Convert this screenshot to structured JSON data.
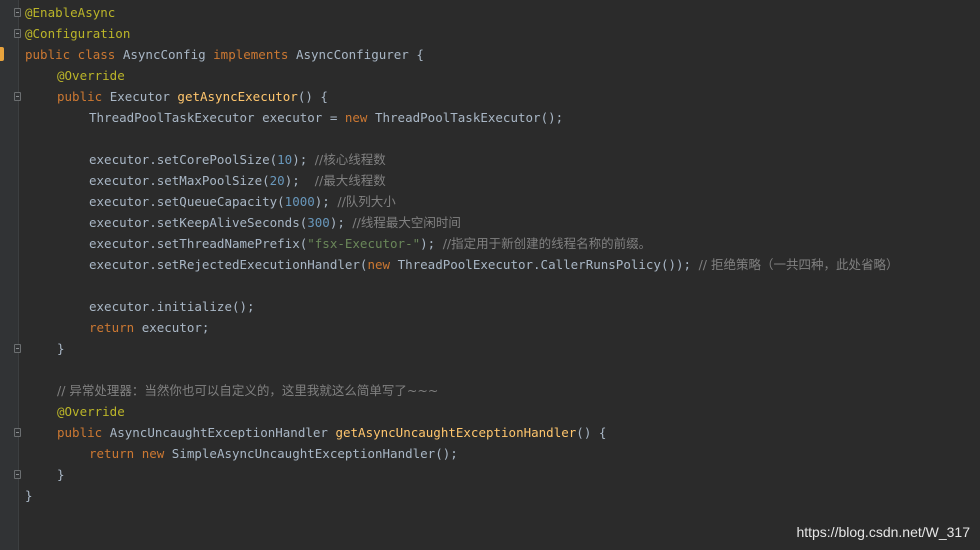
{
  "code": {
    "l1": "@EnableAsync",
    "l2": "@Configuration",
    "l3": {
      "a": "public class ",
      "b": "AsyncConfig ",
      "c": "implements ",
      "d": "AsyncConfigurer {"
    },
    "l4": "@Override",
    "l5": {
      "a": "public ",
      "b": "Executor ",
      "c": "getAsyncExecutor",
      "d": "() {"
    },
    "l6": {
      "a": "ThreadPoolTaskExecutor executor = ",
      "b": "new ",
      "c": "ThreadPoolTaskExecutor",
      "d": "();"
    },
    "l8": {
      "a": "executor.setCorePoolSize(",
      "b": "10",
      "c": "); ",
      "d": "//核心线程数"
    },
    "l9": {
      "a": "executor.setMaxPoolSize(",
      "b": "20",
      "c": ");  ",
      "d": "//最大线程数"
    },
    "l10": {
      "a": "executor.setQueueCapacity(",
      "b": "1000",
      "c": "); ",
      "d": "//队列大小"
    },
    "l11": {
      "a": "executor.setKeepAliveSeconds(",
      "b": "300",
      "c": "); ",
      "d": "//线程最大空闲时间"
    },
    "l12": {
      "a": "executor.setThreadNamePrefix(",
      "b": "\"fsx-Executor-\"",
      "c": "); ",
      "d": "//指定用于新创建的线程名称的前缀。"
    },
    "l13": {
      "a": "executor.setRejectedExecutionHandler(",
      "b": "new ",
      "c": "ThreadPoolExecutor.CallerRunsPolicy()); ",
      "d": "// 拒绝策略（一共四种，此处省略）"
    },
    "l15": "executor.initialize();",
    "l16": {
      "a": "return ",
      "b": "executor;"
    },
    "l17": "}",
    "l19": "// 异常处理器：当然你也可以自定义的，这里我就这么简单写了~~~",
    "l20": "@Override",
    "l21": {
      "a": "public ",
      "b": "AsyncUncaughtExceptionHandler ",
      "c": "getAsyncUncaughtExceptionHandler",
      "d": "() {"
    },
    "l22": {
      "a": "return ",
      "b": "new ",
      "c": "SimpleAsyncUncaughtExceptionHandler();"
    },
    "l23": "}",
    "l24": "}"
  },
  "watermark": "https://blog.csdn.net/W_317",
  "colors": {
    "background": "#2b2b2b",
    "keyword": "#cc7832",
    "annotation": "#bbb529",
    "function": "#ffc66d",
    "number": "#6897bb",
    "string": "#6a8759",
    "comment": "#808080",
    "text": "#a9b7c6"
  }
}
